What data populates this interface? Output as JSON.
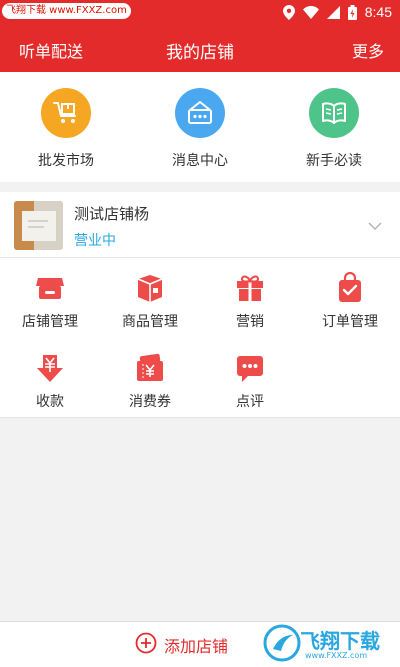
{
  "status_bar": {
    "watermark_text": "飞翔下载 www.FXXZ.com",
    "time": "8:45"
  },
  "header": {
    "left": "听单配送",
    "title": "我的店铺",
    "right": "更多"
  },
  "quick_actions": [
    {
      "label": "批发市场",
      "icon": "wholesale-cart-icon",
      "color": "#f5a623"
    },
    {
      "label": "消息中心",
      "icon": "message-box-icon",
      "color": "#4aa8f0"
    },
    {
      "label": "新手必读",
      "icon": "open-book-icon",
      "color": "#4ec38a"
    }
  ],
  "store": {
    "name": "测试店铺杨",
    "status": "营业中"
  },
  "grid": [
    {
      "label": "店铺管理",
      "icon": "store-icon"
    },
    {
      "label": "商品管理",
      "icon": "product-box-icon"
    },
    {
      "label": "营销",
      "icon": "gift-icon"
    },
    {
      "label": "订单管理",
      "icon": "order-bag-icon"
    },
    {
      "label": "收款",
      "icon": "yuan-receive-icon"
    },
    {
      "label": "消费券",
      "icon": "coupon-icon"
    },
    {
      "label": "点评",
      "icon": "comment-icon"
    }
  ],
  "bottom": {
    "add_label": "添加店铺"
  },
  "watermark": {
    "brand": "飞翔下载",
    "url": "www.FXXZ.com"
  },
  "colors": {
    "primary": "#e32b2b",
    "icon_red": "#ee4b4b",
    "accent_blue": "#2aa7e0"
  }
}
